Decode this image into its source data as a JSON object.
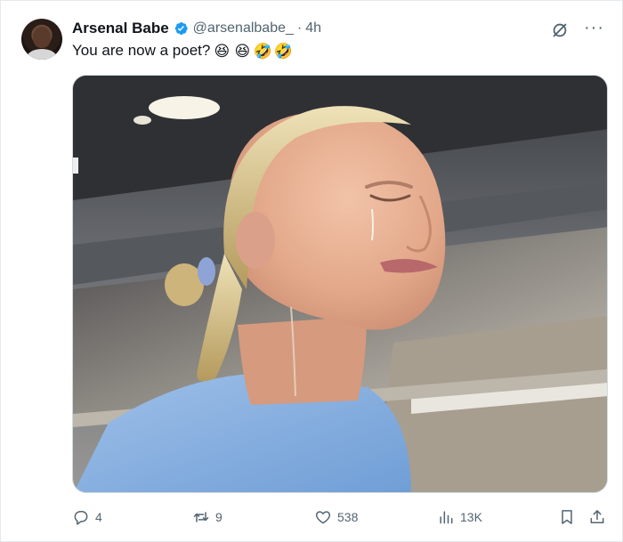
{
  "author": {
    "name": "Arsenal Babe",
    "handle": "@arsenalbabe_",
    "separator": "·",
    "time": "4h"
  },
  "tweet": {
    "text": "You are now a poet?",
    "emojis": [
      "😆",
      "😆",
      "🤣",
      "🤣"
    ]
  },
  "stats": {
    "replies": "4",
    "reposts": "9",
    "likes": "538",
    "views": "13K"
  },
  "colors": {
    "verified": "#1d9bf0",
    "icon_gray": "#536471",
    "text": "#0f1419"
  },
  "icons": {
    "verified": "verified-badge-icon",
    "grok": "grok-icon",
    "more": "more-options-icon",
    "reply": "reply-icon",
    "repost": "repost-icon",
    "like": "like-icon",
    "views": "views-icon",
    "bookmark": "bookmark-icon",
    "share": "share-icon"
  },
  "more_label": "···"
}
